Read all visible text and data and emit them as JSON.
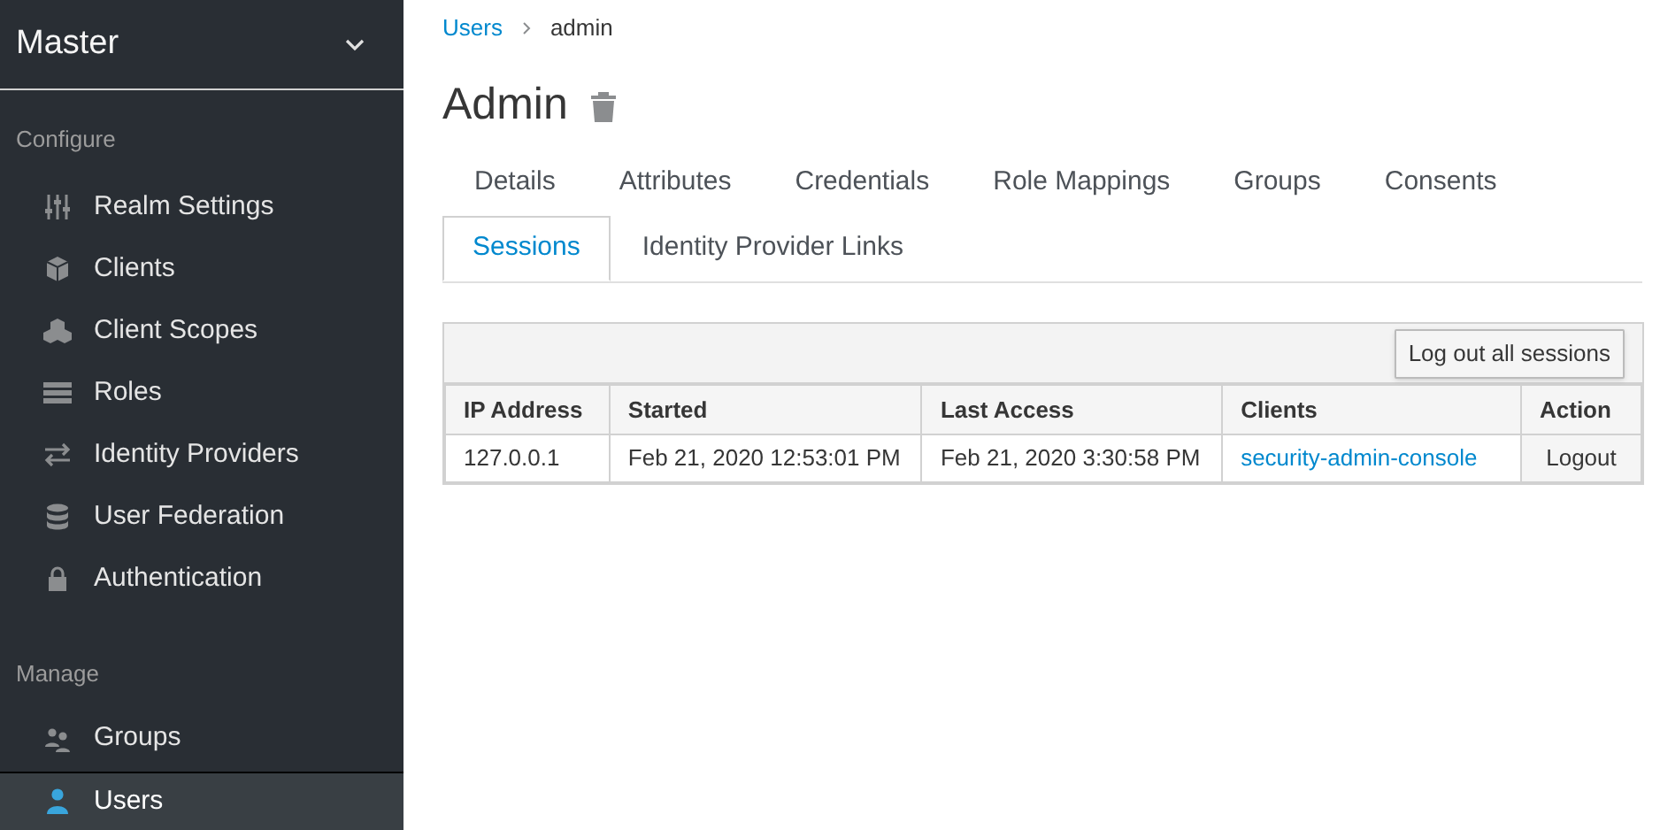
{
  "sidebar": {
    "realm": "Master",
    "sections": [
      {
        "heading": "Configure",
        "items": [
          {
            "label": "Realm Settings",
            "selected": false
          },
          {
            "label": "Clients",
            "selected": false
          },
          {
            "label": "Client Scopes",
            "selected": false
          },
          {
            "label": "Roles",
            "selected": false
          },
          {
            "label": "Identity Providers",
            "selected": false
          },
          {
            "label": "User Federation",
            "selected": false
          },
          {
            "label": "Authentication",
            "selected": false
          }
        ]
      },
      {
        "heading": "Manage",
        "items": [
          {
            "label": "Groups",
            "selected": false
          },
          {
            "label": "Users",
            "selected": true
          }
        ]
      }
    ]
  },
  "breadcrumb": [
    {
      "label": "Users",
      "kind": "link"
    },
    {
      "label": "admin",
      "kind": "current"
    }
  ],
  "title": "Admin",
  "tabs": [
    {
      "label": "Details",
      "selected": false
    },
    {
      "label": "Attributes",
      "selected": false
    },
    {
      "label": "Credentials",
      "selected": false
    },
    {
      "label": "Role Mappings",
      "selected": false
    },
    {
      "label": "Groups",
      "selected": false
    },
    {
      "label": "Consents",
      "selected": false
    },
    {
      "label": "Sessions",
      "selected": true
    },
    {
      "label": "Identity Provider Links",
      "selected": false
    }
  ],
  "toolbar_button": "Log out all sessions",
  "table": {
    "columns": [
      "IP Address",
      "Started",
      "Last Access",
      "Clients",
      "Action"
    ],
    "rows": [
      [
        "127.0.0.1",
        "Feb 21, 2020 12:53:01 PM",
        "Feb 21, 2020 3:30:58 PM",
        "security-admin-console",
        "Logout"
      ]
    ]
  }
}
